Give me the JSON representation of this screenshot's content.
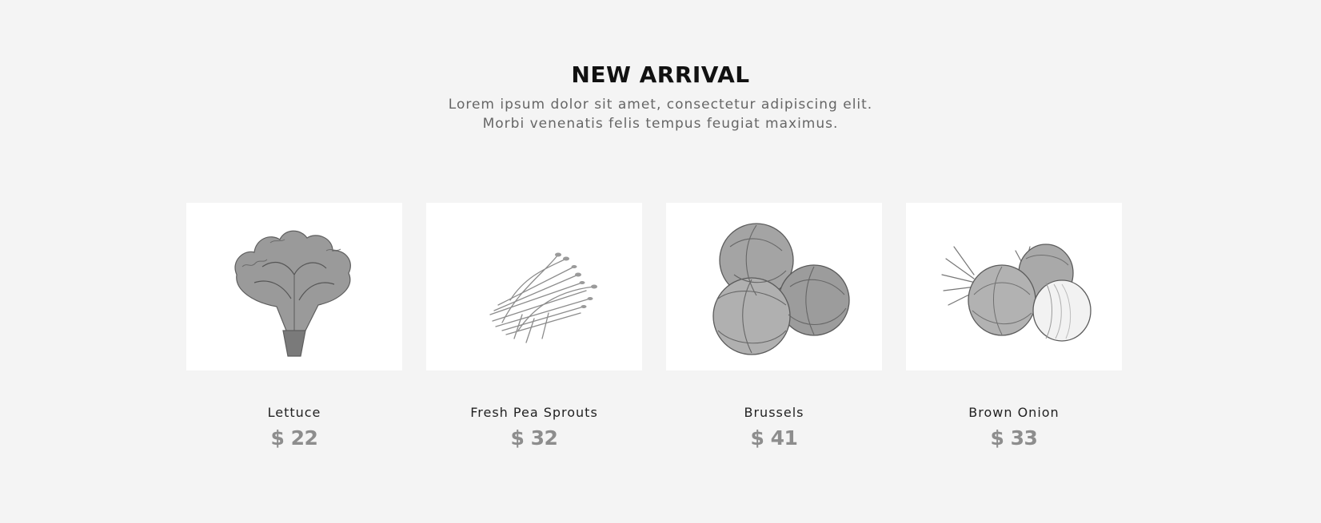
{
  "section": {
    "title": "NEW ARRIVAL",
    "subtitle_line1": "Lorem ipsum dolor sit amet, consectetur adipiscing elit.",
    "subtitle_line2": "Morbi venenatis felis tempus feugiat maximus."
  },
  "products": [
    {
      "name": "Lettuce",
      "price": "$ 22",
      "icon": "lettuce-icon"
    },
    {
      "name": "Fresh Pea Sprouts",
      "price": "$ 32",
      "icon": "pea-sprouts-icon"
    },
    {
      "name": "Brussels",
      "price": "$ 41",
      "icon": "brussels-sprouts-icon"
    },
    {
      "name": "Brown Onion",
      "price": "$ 33",
      "icon": "onion-icon"
    }
  ],
  "colors": {
    "background": "#f4f4f4",
    "card": "#ffffff",
    "title": "#111111",
    "subtitle": "#666666",
    "price": "#8d8d8d"
  }
}
